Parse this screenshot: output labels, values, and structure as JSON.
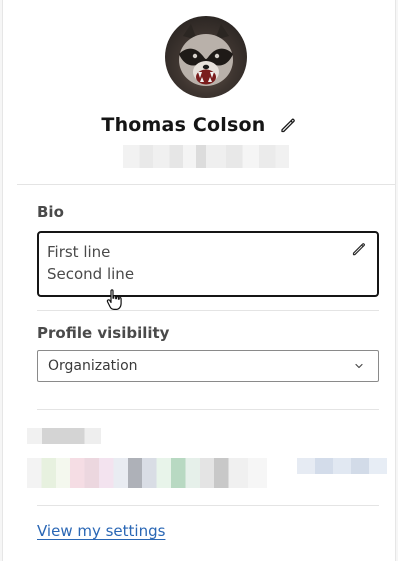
{
  "profile": {
    "name": "Thomas Colson",
    "avatar_icon": "raccoon-avatar"
  },
  "bio": {
    "label": "Bio",
    "lines": [
      "First line",
      "Second line"
    ],
    "edit_icon": "pencil-icon"
  },
  "visibility": {
    "label": "Profile visibility",
    "selected": "Organization"
  },
  "links": {
    "settings": "View my settings"
  },
  "colors": {
    "link": "#2a67b5",
    "text_dark": "#151515",
    "text_muted": "#4a4a4a"
  }
}
